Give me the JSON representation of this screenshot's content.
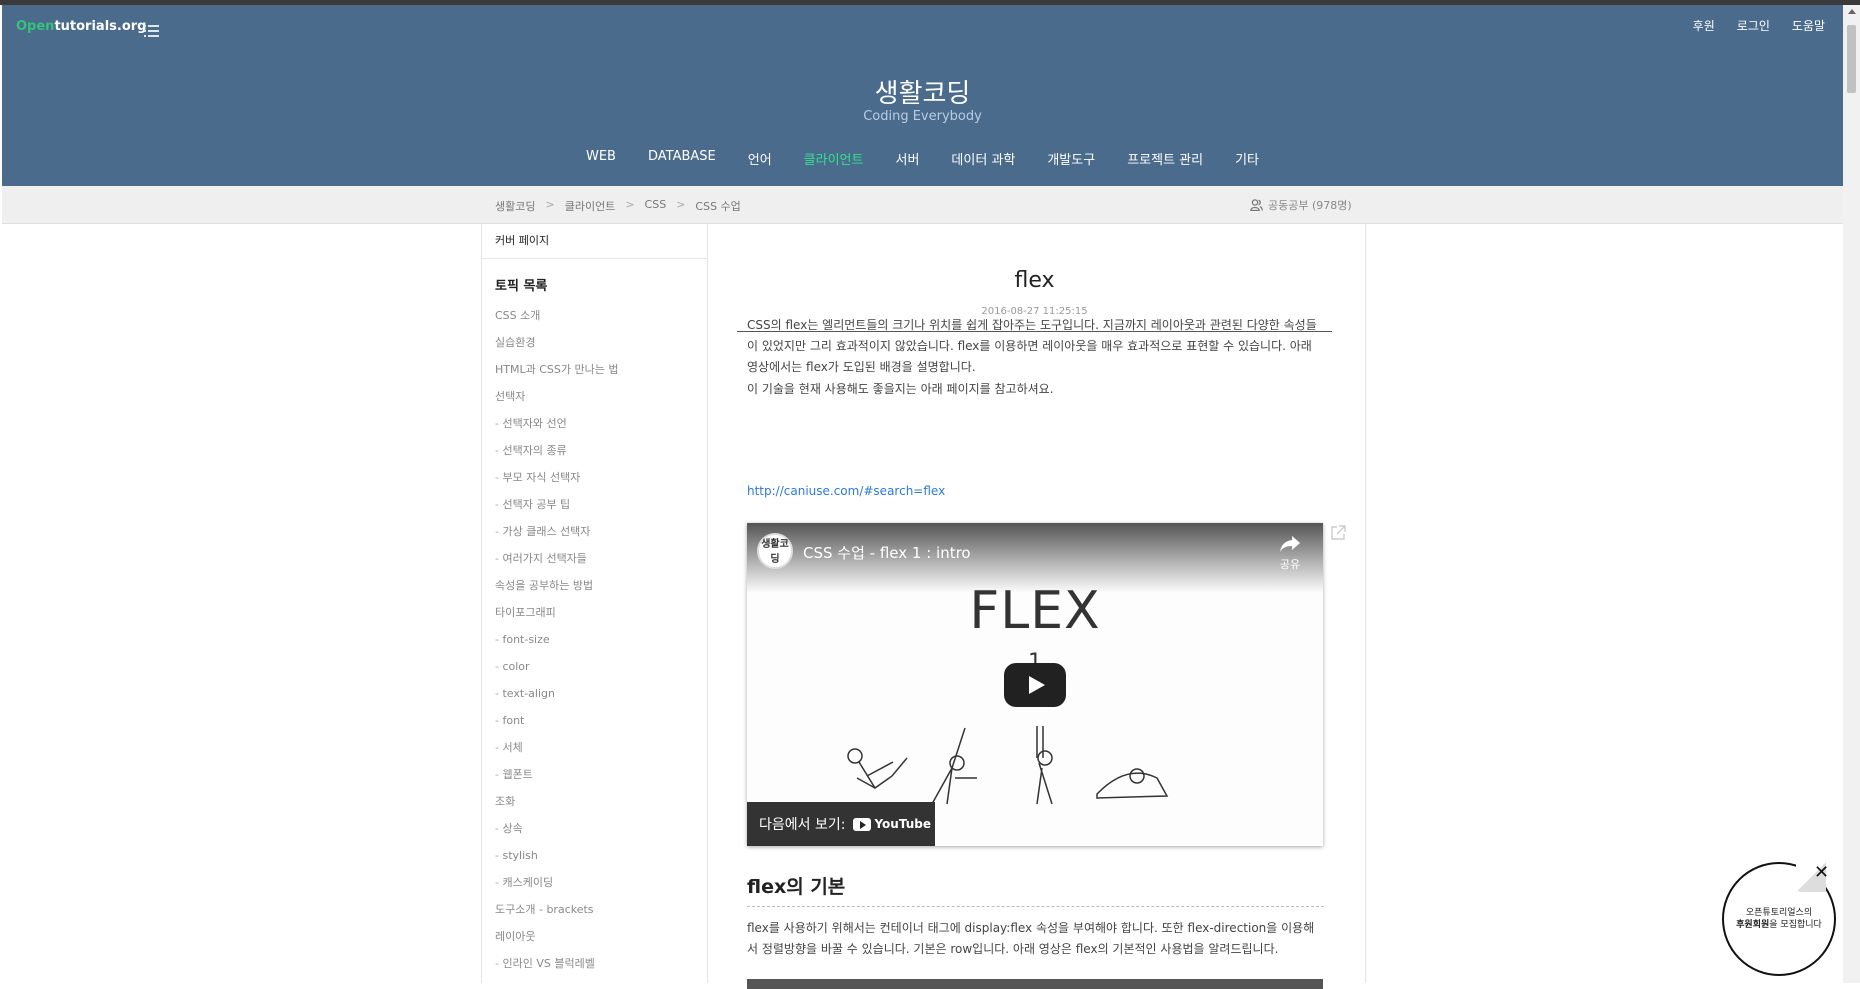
{
  "header": {
    "logo_open": "Open",
    "logo_rest": "tutorials.org",
    "util_links": [
      "후원",
      "로그인",
      "도움말"
    ],
    "site_title": "생활코딩",
    "site_subtitle": "Coding Everybody",
    "nav": [
      "WEB",
      "DATABASE",
      "언어",
      "클라이언트",
      "서버",
      "데이터 과학",
      "개발도구",
      "프로젝트 관리",
      "기타"
    ],
    "nav_active": "클라이언트",
    "colors": {
      "header_bg": "#4a6b8c",
      "active_nav": "#35e08c",
      "brand_green": "#35c27a"
    }
  },
  "breadcrumb": {
    "items": [
      "생활코딩",
      "클라이언트",
      "CSS",
      "CSS 수업"
    ],
    "separator": ">",
    "study_label": "공동공부 (978명)"
  },
  "sidebar": {
    "cover_label": "커버 페이지",
    "topic_heading": "토픽 목록",
    "topics": [
      {
        "label": "CSS 소개",
        "sub": false
      },
      {
        "label": "실습환경",
        "sub": false
      },
      {
        "label": "HTML과 CSS가 만나는 법",
        "sub": false
      },
      {
        "label": "선택자",
        "sub": false
      },
      {
        "label": "선택자와 선언",
        "sub": true
      },
      {
        "label": "선택자의 종류",
        "sub": true
      },
      {
        "label": "부모 자식 선택자",
        "sub": true
      },
      {
        "label": "선택자 공부 팁",
        "sub": true
      },
      {
        "label": "가상 클래스 선택자",
        "sub": true
      },
      {
        "label": "여러가지 선택자들",
        "sub": true
      },
      {
        "label": "속성을 공부하는 방법",
        "sub": false
      },
      {
        "label": "타이포그래피",
        "sub": false
      },
      {
        "label": "font-size",
        "sub": true
      },
      {
        "label": "color",
        "sub": true
      },
      {
        "label": "text-align",
        "sub": true
      },
      {
        "label": "font",
        "sub": true
      },
      {
        "label": "서체",
        "sub": true
      },
      {
        "label": "웹폰트",
        "sub": true
      },
      {
        "label": "조화",
        "sub": false
      },
      {
        "label": "상속",
        "sub": true
      },
      {
        "label": "stylish",
        "sub": true
      },
      {
        "label": "캐스케이딩",
        "sub": true
      },
      {
        "label": "도구소개 - brackets",
        "sub": false
      },
      {
        "label": "레이아웃",
        "sub": false
      },
      {
        "label": "인라인 VS 블럭레벨",
        "sub": true
      }
    ]
  },
  "article": {
    "title": "flex",
    "date": "2016-08-27 11:25:15",
    "para1": "CSS의 flex는 엘리먼트들의 크기나 위치를 쉽게 잡아주는 도구입니다. 지금까지 레이아웃과 관련된 다양한 속성들이 있었지만 그리 효과적이지 않았습니다. flex를 이용하면 레이아웃을 매우 효과적으로 표현할 수 있습니다. 아래 영상에서는 flex가 도입된 배경을 설명합니다.",
    "para2": "이 기술을 현재 사용해도 좋을지는 아래 페이지를 참고하셔요.",
    "link": "http://caniuse.com/#search=flex",
    "video": {
      "title": "CSS 수업 - flex 1 : intro",
      "share_label": "공유",
      "big_text": "FLEX",
      "big_number": "1",
      "avatar_text": "생활코딩",
      "watch_on": "다음에서 보기:",
      "youtube": "YouTube"
    },
    "section_heading": "flex의 기본",
    "para3": "flex를 사용하기 위해서는 컨테이너 태그에 display:flex 속성을 부여해야 합니다. 또한 flex-direction을 이용해서 정렬방향을 바꿀 수 있습니다. 기본은 row입니다. 아래 영상은 flex의 기본적인 사용법을 알려드립니다."
  },
  "badge": {
    "line1": "오픈튜토리얼스의",
    "line2_bold": "후원회원",
    "line2_rest": "을 모집합니다"
  }
}
